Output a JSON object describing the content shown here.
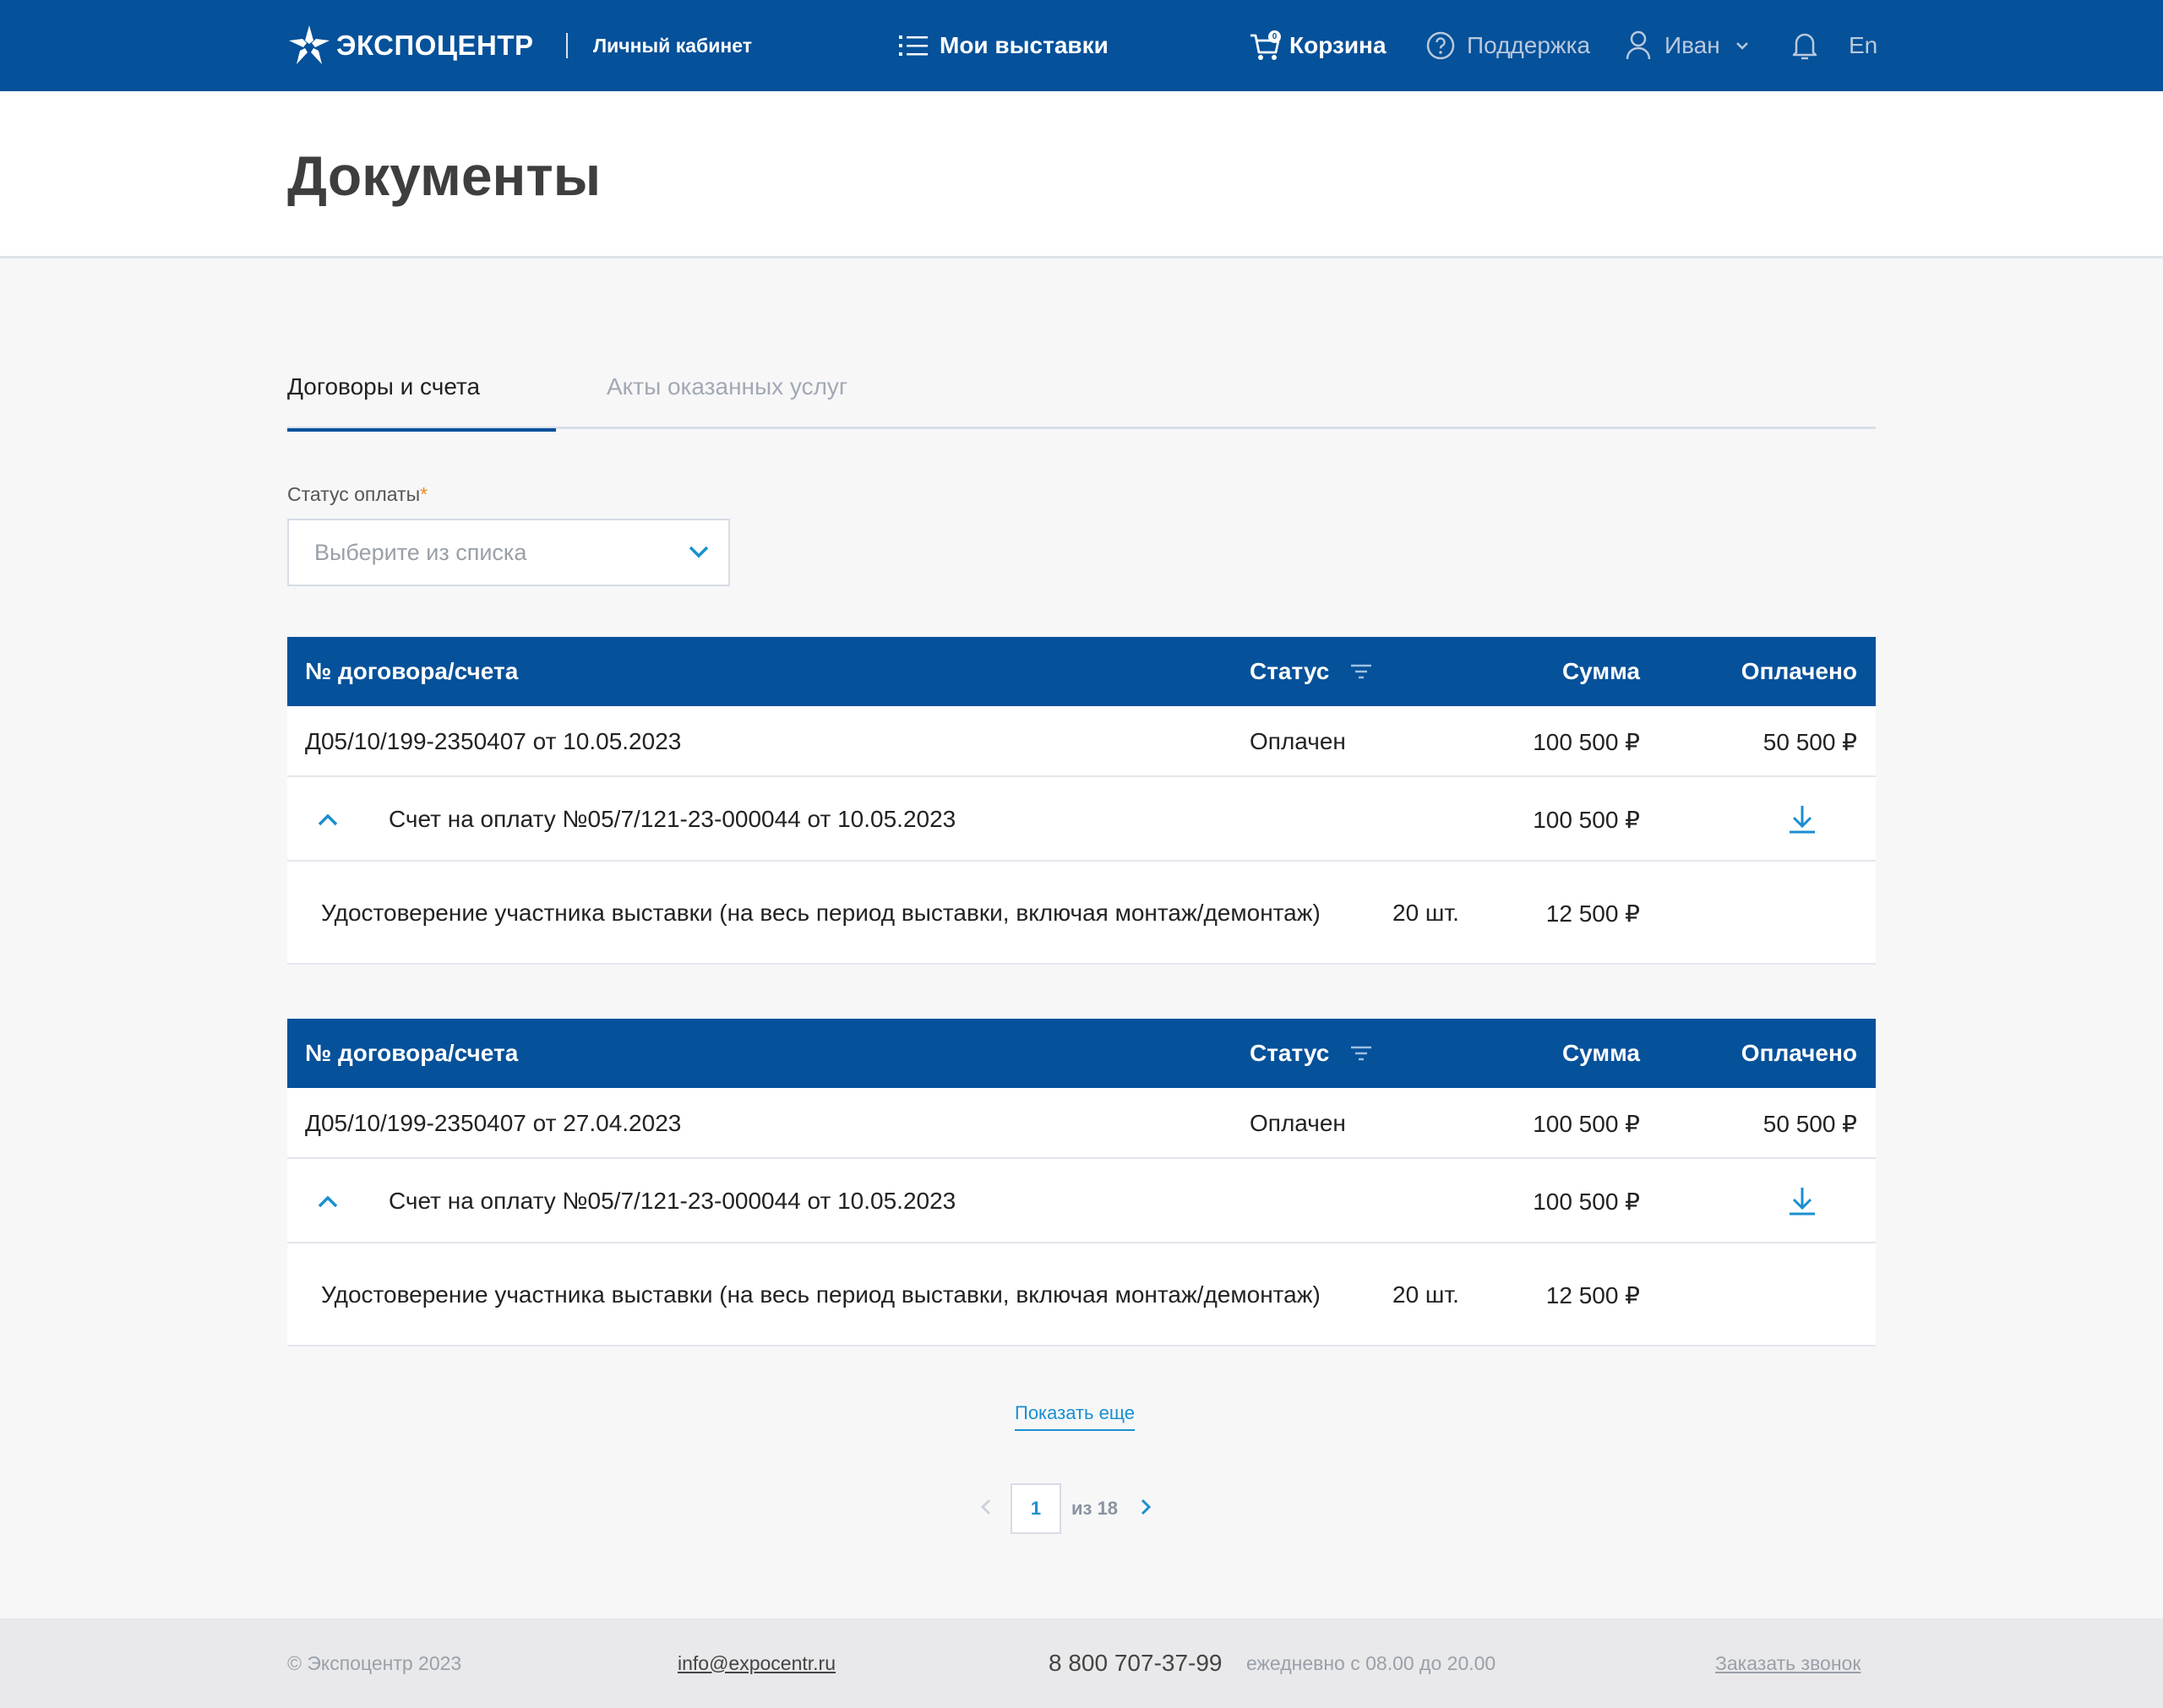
{
  "header": {
    "logo_text": "ЭКСПОЦЕНТР",
    "cabinet_label": "Личный кабинет",
    "my_exhibitions": "Мои выставки",
    "cart_label": "Корзина",
    "cart_badge": "0",
    "support_label": "Поддержка",
    "user_name": "Иван",
    "lang": "En"
  },
  "page": {
    "title": "Документы"
  },
  "tabs": [
    {
      "label": "Договоры и счета",
      "active": true
    },
    {
      "label": "Акты оказанных услуг",
      "active": false
    }
  ],
  "filter": {
    "label": "Статус оплаты",
    "required_mark": "*",
    "placeholder": "Выберите из списка"
  },
  "table_header": {
    "number": "№ договора/счета",
    "status": "Статус",
    "sum": "Сумма",
    "paid": "Оплачено"
  },
  "contracts": [
    {
      "number": "Д05/10/199-2350407 от 10.05.2023",
      "status": "Оплачен",
      "sum": "100 500 ₽",
      "paid": "50 500 ₽",
      "invoice": {
        "title": "Счет на оплату №05/7/121-23-000044 от 10.05.2023",
        "sum": "100 500 ₽"
      },
      "item": {
        "title": "Удостоверение участника выставки (на весь период выставки, включая монтаж/демонтаж)",
        "qty": "20 шт.",
        "sum": "12 500 ₽"
      }
    },
    {
      "number": "Д05/10/199-2350407 от 27.04.2023",
      "status": "Оплачен",
      "sum": "100 500 ₽",
      "paid": "50 500 ₽",
      "invoice": {
        "title": "Счет на оплату №05/7/121-23-000044 от 10.05.2023",
        "sum": "100 500 ₽"
      },
      "item": {
        "title": "Удостоверение участника выставки (на весь период выставки, включая монтаж/демонтаж)",
        "qty": "20 шт.",
        "sum": "12 500 ₽"
      }
    }
  ],
  "show_more": "Показать еще",
  "pagination": {
    "current": "1",
    "of": "из 18"
  },
  "footer": {
    "copyright": "© Экспоцентр 2023",
    "email": "info@expocentr.ru",
    "phone": "8 800 707-37-99",
    "hours": "ежедневно с 08.00 до 20.00",
    "callback": "Заказать звонок"
  },
  "colors": {
    "brand_blue": "#05519a",
    "accent_cyan": "#1a8fd0",
    "required_orange": "#f08a1c",
    "page_bg": "#f7f7f8"
  },
  "icons": [
    "logo-star-icon",
    "list-icon",
    "cart-icon",
    "help-circle-icon",
    "user-icon",
    "chevron-down-icon",
    "bell-icon",
    "filter-icon",
    "chevron-up-icon",
    "download-icon",
    "chevron-left-icon",
    "chevron-right-icon"
  ]
}
